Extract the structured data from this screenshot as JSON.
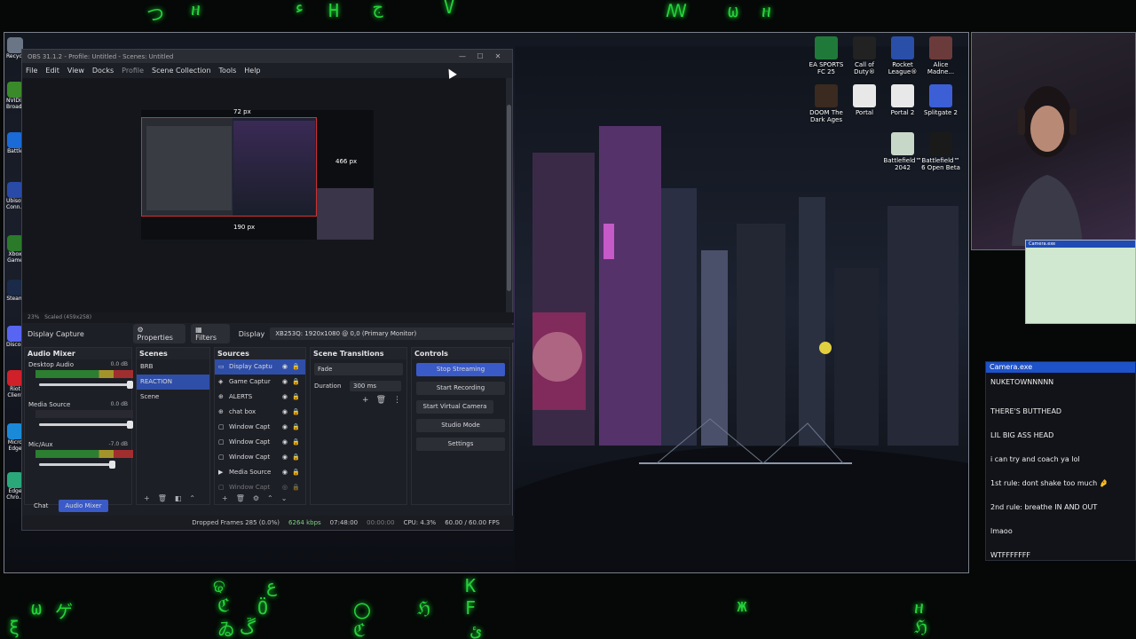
{
  "obs": {
    "title": "OBS 31.1.2 - Profile: Untitled - Scenes: Untitled",
    "menu": [
      "File",
      "Edit",
      "View",
      "Docks",
      "Profile",
      "Scene Collection",
      "Tools",
      "Help"
    ],
    "preview": {
      "dim_top": "72 px",
      "dim_right": "466 px",
      "dim_bottom": "190 px",
      "zoom": "23%",
      "scaled": "Scaled (459x258)"
    },
    "properties_bar": {
      "source": "Display Capture",
      "properties_label": "Properties",
      "filters_label": "Filters",
      "display_label": "Display",
      "display_value": "XB253Q: 1920x1080 @ 0,0 (Primary Monitor)"
    },
    "audio_mixer": {
      "title": "Audio Mixer",
      "channels": [
        {
          "name": "Desktop Audio",
          "db": "0.0 dB"
        },
        {
          "name": "Media Source",
          "db": "0.0 dB"
        },
        {
          "name": "Mic/Aux",
          "db": "-7.0 dB"
        }
      ]
    },
    "scenes": {
      "title": "Scenes",
      "items": [
        "BRB",
        "REACTION",
        "Scene"
      ],
      "selected": 1
    },
    "sources": {
      "title": "Sources",
      "items": [
        "Display Captu",
        "Game Captur",
        "ALERTS",
        "chat box",
        "Window Capt",
        "Window Capt",
        "Window Capt",
        "Media Source",
        "Window Capt"
      ],
      "selected": 0
    },
    "transitions": {
      "title": "Scene Transitions",
      "type": "Fade",
      "duration_label": "Duration",
      "duration_value": "300 ms"
    },
    "controls": {
      "title": "Controls",
      "stop_streaming": "Stop Streaming",
      "start_recording": "Start Recording",
      "start_virtual_camera": "Start Virtual Camera",
      "studio_mode": "Studio Mode",
      "settings": "Settings"
    },
    "bottom_tabs": [
      "Chat",
      "Audio Mixer"
    ],
    "status": {
      "dropped": "Dropped Frames 285 (0.0%)",
      "bitrate": "6264 kbps",
      "stream_time": "07:48:00",
      "rec_time": "00:00:00",
      "cpu": "CPU: 4.3%",
      "fps": "60.00 / 60.00 FPS"
    }
  },
  "desktop_icons": [
    {
      "label": "EA SPORTS FC 25",
      "color": "#1f7a3a"
    },
    {
      "label": "Call of Duty®",
      "color": "#222222"
    },
    {
      "label": "Rocket League®",
      "color": "#2a4fa8"
    },
    {
      "label": "Alice Madne...",
      "color": "#6b3b3b"
    },
    {
      "label": "DOOM The Dark Ages",
      "color": "#3a2a20"
    },
    {
      "label": "Portal",
      "color": "#e8e8e8"
    },
    {
      "label": "Portal 2",
      "color": "#e8e8e8"
    },
    {
      "label": "Splitgate 2",
      "color": "#3c5fd6"
    },
    {
      "label": "Battlefield™ 2042",
      "color": "#c8d8c8"
    },
    {
      "label": "Battlefield™ 6 Open Beta",
      "color": "#1a1a1a"
    }
  ],
  "left_icons": [
    "Recycle",
    "NVIDIA Broad...",
    "Battle",
    "Ubisoft Conn...",
    "Xbox Game",
    "Steam",
    "Discord",
    "Riot Client",
    "Micro Edge",
    "Edge Chro..."
  ],
  "webcam_label": "Camera.exe",
  "chat": {
    "title": "Camera.exe",
    "messages": [
      "NUKETOWNNNNN",
      "THERE'S BUTTHEAD",
      "LIL BIG ASS HEAD",
      "i can try and coach ya lol",
      "1st rule: dont shake too much 🤌",
      "2nd rule: breathe IN AND OUT",
      "lmaoo",
      "WTFFFFFFF"
    ]
  },
  "matrix_glyphs": [
    "つ",
    "ዘ",
    "H",
    "ج",
    "V",
    "ꟿ",
    "ω",
    "ዘ",
    "ء",
    "ଢ",
    "ع",
    "ℭ",
    "ゐ",
    "Ö",
    "〇",
    "ℌ",
    "F",
    "ж",
    "ℭ",
    "ڱ",
    "K",
    "ئ",
    "ω",
    "ゲ",
    "ξ",
    "ዘ",
    "ℌ"
  ],
  "colors": {
    "obs_bg": "#1d1f26",
    "accent_blue": "#3a5ac8",
    "matrix_green": "#26d13a",
    "chat_header": "#1e52c9"
  }
}
